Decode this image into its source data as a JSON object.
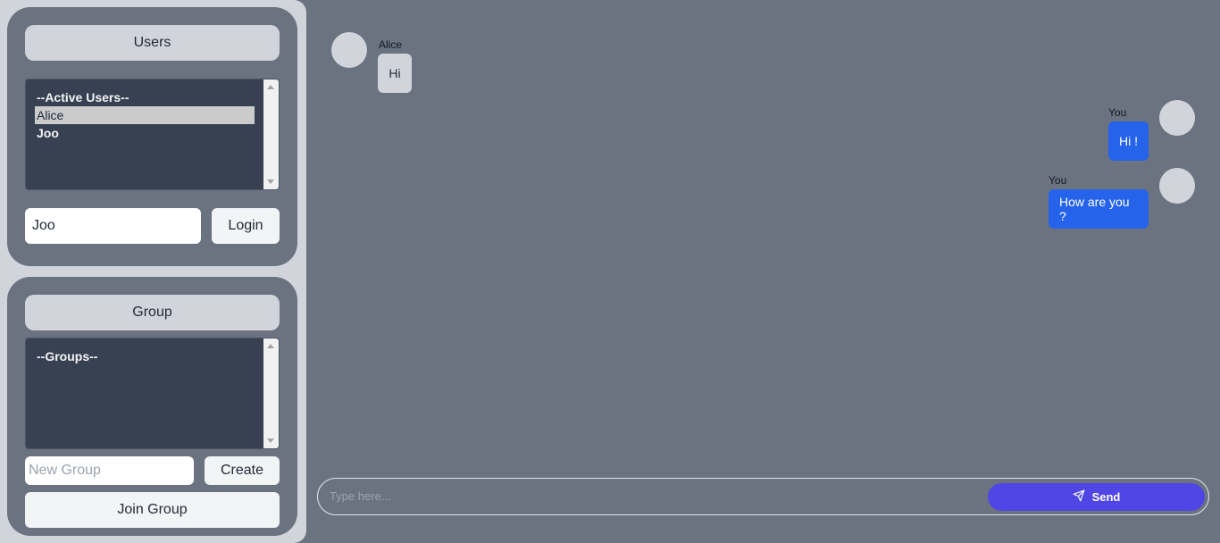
{
  "users_panel": {
    "header": "Users",
    "list_title": "--Active Users--",
    "items": [
      "Alice",
      "Joo"
    ],
    "selected": "Alice",
    "username_value": "Joo",
    "login_label": "Login"
  },
  "group_panel": {
    "header": "Group",
    "list_title": "--Groups--",
    "new_group_placeholder": "New Group",
    "create_label": "Create",
    "join_label": "Join Group"
  },
  "messages": [
    {
      "sender": "Alice",
      "text": "Hi",
      "side": "left"
    },
    {
      "sender": "You",
      "text": "Hi !",
      "side": "right"
    },
    {
      "sender": "You",
      "text": "How are you ?",
      "side": "right"
    }
  ],
  "composer": {
    "placeholder": "Type here...",
    "send_label": "Send",
    "send_icon": "paper-plane-icon"
  },
  "colors": {
    "background": "#6b7280",
    "sidebar": "#d1d5db",
    "listbox": "#374151",
    "my_bubble": "#2563eb",
    "send_button": "#4f46e5"
  }
}
